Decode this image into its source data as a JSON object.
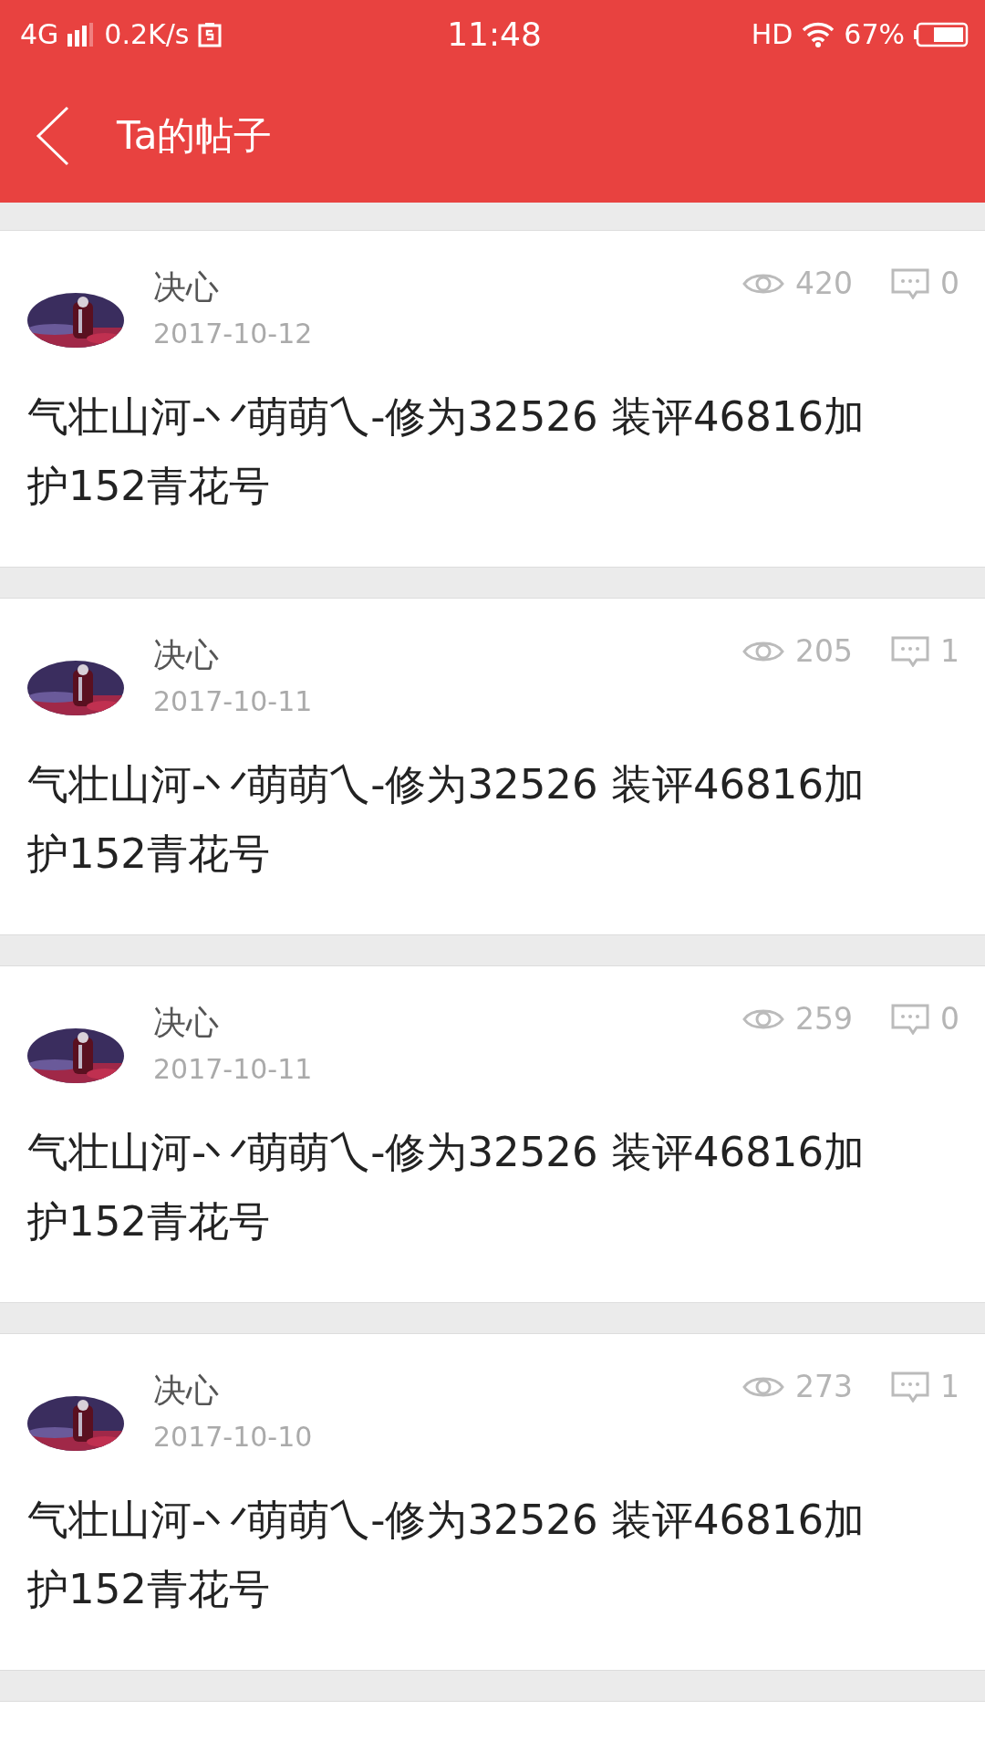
{
  "status_bar": {
    "network": "4G",
    "speed": "0.2K/s",
    "time": "11:48",
    "hd": "HD",
    "battery": "67%"
  },
  "header": {
    "title": "Ta的帖子"
  },
  "posts": [
    {
      "author": "决心",
      "date": "2017-10-12",
      "views": "420",
      "comments": "0",
      "title": "气壮山河-丷萌萌乀-修为32526 装评46816加护152青花号"
    },
    {
      "author": "决心",
      "date": "2017-10-11",
      "views": "205",
      "comments": "1",
      "title": "气壮山河-丷萌萌乀-修为32526 装评46816加护152青花号"
    },
    {
      "author": "决心",
      "date": "2017-10-11",
      "views": "259",
      "comments": "0",
      "title": "气壮山河-丷萌萌乀-修为32526 装评46816加护152青花号"
    },
    {
      "author": "决心",
      "date": "2017-10-10",
      "views": "273",
      "comments": "1",
      "title": "气壮山河-丷萌萌乀-修为32526 装评46816加护152青花号"
    }
  ]
}
